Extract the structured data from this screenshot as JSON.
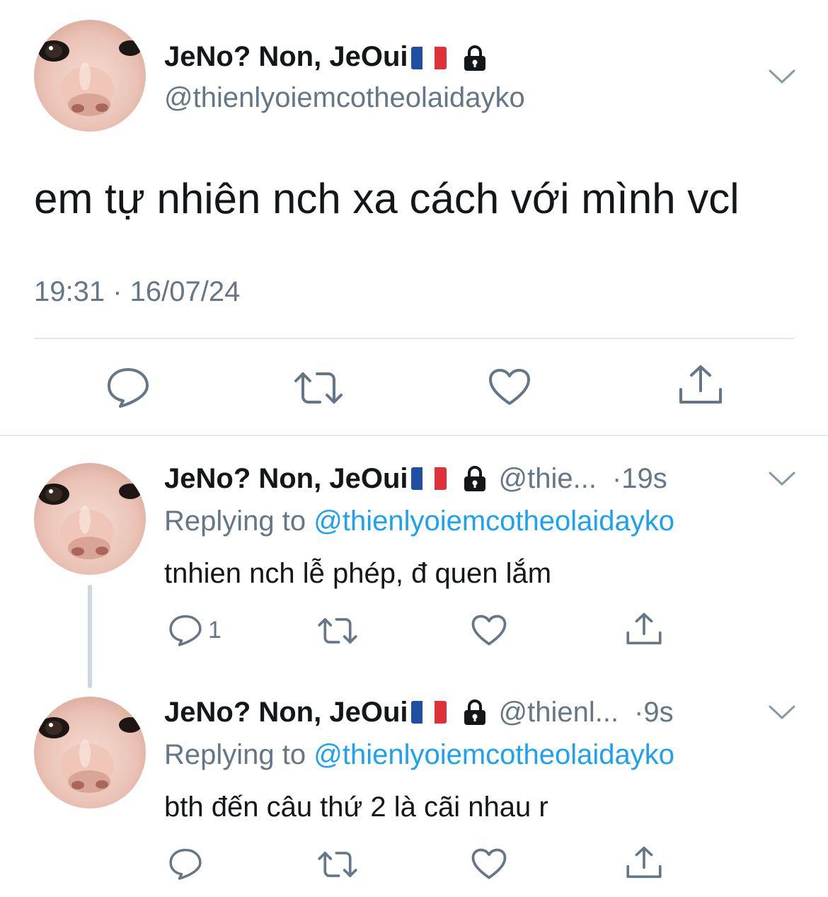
{
  "main_tweet": {
    "display_name": "JeNo? Non, JeOui",
    "handle": "@thienlyoiemcotheolaidayko",
    "text": "em tự nhiên nch xa cách với mình vcl",
    "timestamp": "19:31 · 16/07/24",
    "flag_colors": [
      "#1f4fa3",
      "#ffffff",
      "#e0303a"
    ]
  },
  "replies": [
    {
      "display_name": "JeNo? Non, JeOui",
      "handle": "@thie...",
      "time": "·19s",
      "replying_prefix": "Replying to",
      "replying_handle": "@thienlyoiemcotheolaidayko",
      "text": "tnhien nch lễ phép, đ quen lắm",
      "reply_count": "1"
    },
    {
      "display_name": "JeNo? Non, JeOui",
      "handle": "@thienl...",
      "time": "·9s",
      "replying_prefix": "Replying to",
      "replying_handle": "@thienlyoiemcotheolaidayko",
      "text": "bth đến câu thứ 2 là cãi nhau r",
      "reply_count": ""
    }
  ],
  "colors": {
    "text": "#14171a",
    "secondary": "#657786",
    "link": "#1da1f2",
    "divider": "#e1e8ed",
    "thread_line": "#ccd6dd"
  },
  "icons": [
    "avatar",
    "flag-fr-icon",
    "lock-icon",
    "chevron-down-icon",
    "reply-icon",
    "retweet-icon",
    "like-icon",
    "share-icon"
  ]
}
